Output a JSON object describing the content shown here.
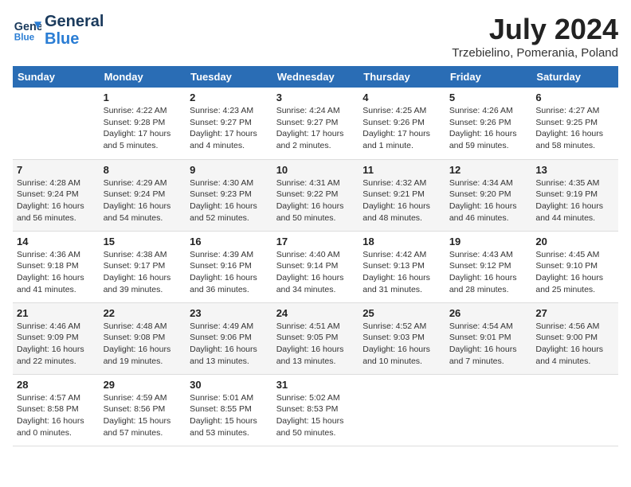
{
  "logo": {
    "line1": "General",
    "line2": "Blue"
  },
  "title": "July 2024",
  "location": "Trzebielino, Pomerania, Poland",
  "columns": [
    "Sunday",
    "Monday",
    "Tuesday",
    "Wednesday",
    "Thursday",
    "Friday",
    "Saturday"
  ],
  "weeks": [
    [
      {
        "day": "",
        "info": ""
      },
      {
        "day": "1",
        "info": "Sunrise: 4:22 AM\nSunset: 9:28 PM\nDaylight: 17 hours\nand 5 minutes."
      },
      {
        "day": "2",
        "info": "Sunrise: 4:23 AM\nSunset: 9:27 PM\nDaylight: 17 hours\nand 4 minutes."
      },
      {
        "day": "3",
        "info": "Sunrise: 4:24 AM\nSunset: 9:27 PM\nDaylight: 17 hours\nand 2 minutes."
      },
      {
        "day": "4",
        "info": "Sunrise: 4:25 AM\nSunset: 9:26 PM\nDaylight: 17 hours\nand 1 minute."
      },
      {
        "day": "5",
        "info": "Sunrise: 4:26 AM\nSunset: 9:26 PM\nDaylight: 16 hours\nand 59 minutes."
      },
      {
        "day": "6",
        "info": "Sunrise: 4:27 AM\nSunset: 9:25 PM\nDaylight: 16 hours\nand 58 minutes."
      }
    ],
    [
      {
        "day": "7",
        "info": "Sunrise: 4:28 AM\nSunset: 9:24 PM\nDaylight: 16 hours\nand 56 minutes."
      },
      {
        "day": "8",
        "info": "Sunrise: 4:29 AM\nSunset: 9:24 PM\nDaylight: 16 hours\nand 54 minutes."
      },
      {
        "day": "9",
        "info": "Sunrise: 4:30 AM\nSunset: 9:23 PM\nDaylight: 16 hours\nand 52 minutes."
      },
      {
        "day": "10",
        "info": "Sunrise: 4:31 AM\nSunset: 9:22 PM\nDaylight: 16 hours\nand 50 minutes."
      },
      {
        "day": "11",
        "info": "Sunrise: 4:32 AM\nSunset: 9:21 PM\nDaylight: 16 hours\nand 48 minutes."
      },
      {
        "day": "12",
        "info": "Sunrise: 4:34 AM\nSunset: 9:20 PM\nDaylight: 16 hours\nand 46 minutes."
      },
      {
        "day": "13",
        "info": "Sunrise: 4:35 AM\nSunset: 9:19 PM\nDaylight: 16 hours\nand 44 minutes."
      }
    ],
    [
      {
        "day": "14",
        "info": "Sunrise: 4:36 AM\nSunset: 9:18 PM\nDaylight: 16 hours\nand 41 minutes."
      },
      {
        "day": "15",
        "info": "Sunrise: 4:38 AM\nSunset: 9:17 PM\nDaylight: 16 hours\nand 39 minutes."
      },
      {
        "day": "16",
        "info": "Sunrise: 4:39 AM\nSunset: 9:16 PM\nDaylight: 16 hours\nand 36 minutes."
      },
      {
        "day": "17",
        "info": "Sunrise: 4:40 AM\nSunset: 9:14 PM\nDaylight: 16 hours\nand 34 minutes."
      },
      {
        "day": "18",
        "info": "Sunrise: 4:42 AM\nSunset: 9:13 PM\nDaylight: 16 hours\nand 31 minutes."
      },
      {
        "day": "19",
        "info": "Sunrise: 4:43 AM\nSunset: 9:12 PM\nDaylight: 16 hours\nand 28 minutes."
      },
      {
        "day": "20",
        "info": "Sunrise: 4:45 AM\nSunset: 9:10 PM\nDaylight: 16 hours\nand 25 minutes."
      }
    ],
    [
      {
        "day": "21",
        "info": "Sunrise: 4:46 AM\nSunset: 9:09 PM\nDaylight: 16 hours\nand 22 minutes."
      },
      {
        "day": "22",
        "info": "Sunrise: 4:48 AM\nSunset: 9:08 PM\nDaylight: 16 hours\nand 19 minutes."
      },
      {
        "day": "23",
        "info": "Sunrise: 4:49 AM\nSunset: 9:06 PM\nDaylight: 16 hours\nand 13 minutes."
      },
      {
        "day": "24",
        "info": "Sunrise: 4:51 AM\nSunset: 9:05 PM\nDaylight: 16 hours\nand 13 minutes."
      },
      {
        "day": "25",
        "info": "Sunrise: 4:52 AM\nSunset: 9:03 PM\nDaylight: 16 hours\nand 10 minutes."
      },
      {
        "day": "26",
        "info": "Sunrise: 4:54 AM\nSunset: 9:01 PM\nDaylight: 16 hours\nand 7 minutes."
      },
      {
        "day": "27",
        "info": "Sunrise: 4:56 AM\nSunset: 9:00 PM\nDaylight: 16 hours\nand 4 minutes."
      }
    ],
    [
      {
        "day": "28",
        "info": "Sunrise: 4:57 AM\nSunset: 8:58 PM\nDaylight: 16 hours\nand 0 minutes."
      },
      {
        "day": "29",
        "info": "Sunrise: 4:59 AM\nSunset: 8:56 PM\nDaylight: 15 hours\nand 57 minutes."
      },
      {
        "day": "30",
        "info": "Sunrise: 5:01 AM\nSunset: 8:55 PM\nDaylight: 15 hours\nand 53 minutes."
      },
      {
        "day": "31",
        "info": "Sunrise: 5:02 AM\nSunset: 8:53 PM\nDaylight: 15 hours\nand 50 minutes."
      },
      {
        "day": "",
        "info": ""
      },
      {
        "day": "",
        "info": ""
      },
      {
        "day": "",
        "info": ""
      }
    ]
  ]
}
